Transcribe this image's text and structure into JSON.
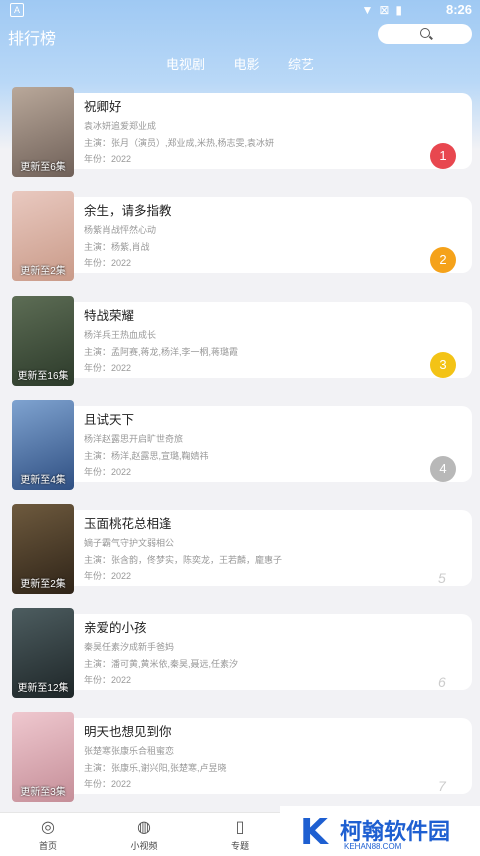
{
  "statusbar": {
    "time": "8:26",
    "app_badge": "A"
  },
  "header": {
    "title": "排行榜"
  },
  "tabs": [
    {
      "label": "电视剧"
    },
    {
      "label": "电影"
    },
    {
      "label": "综艺"
    }
  ],
  "items": [
    {
      "name": "祝卿好",
      "desc": "袁冰妍追爱郑业成",
      "cast": "主演：张月（演员）,郑业成,米热,杨志雯,袁冰妍",
      "year": "年份：2022",
      "episode": "更新至6集",
      "rank": "1",
      "rank_color": "#e8474f",
      "poster_colors": [
        "#b9a89a",
        "#6f6058"
      ]
    },
    {
      "name": "余生，请多指教",
      "desc": "杨紫肖战怦然心动",
      "cast": "主演：杨紫,肖战",
      "year": "年份：2022",
      "episode": "更新至2集",
      "rank": "2",
      "rank_color": "#f5a21a",
      "poster_colors": [
        "#e9c9c0",
        "#c99a88"
      ]
    },
    {
      "name": "特战荣耀",
      "desc": "杨洋兵王热血成长",
      "cast": "主演：孟阿赛,蒋龙,杨洋,李一桐,蒋璐霞",
      "year": "年份：2022",
      "episode": "更新至16集",
      "rank": "3",
      "rank_color": "#f3c316",
      "poster_colors": [
        "#5d6d55",
        "#2c3a2a"
      ]
    },
    {
      "name": "且试天下",
      "desc": "杨洋赵露思开启旷世奇旅",
      "cast": "主演：杨洋,赵露思,宣璐,鞠婧祎",
      "year": "年份：2022",
      "episode": "更新至4集",
      "rank": "4",
      "rank_color": "#b8b8b8",
      "poster_colors": [
        "#7fa3d0",
        "#2f4f82"
      ]
    },
    {
      "name": "玉面桃花总相逢",
      "desc": "嫡子霸气守护文弱相公",
      "cast": "主演：张含韵，佟梦实，陈奕龙，王若麟，龐惠子",
      "year": "年份：2022",
      "episode": "更新至2集",
      "rank": "5",
      "poster_colors": [
        "#6e5a3e",
        "#2f2418"
      ]
    },
    {
      "name": "亲爱的小孩",
      "desc": "秦昊任素汐成新手爸妈",
      "cast": "主演：潘可黄,黄米依,秦昊,聂远,任素汐",
      "year": "年份：2022",
      "episode": "更新至12集",
      "rank": "6",
      "poster_colors": [
        "#4d5d60",
        "#1e2628"
      ]
    },
    {
      "name": "明天也想见到你",
      "desc": "张楚寒张康乐合租蜜恋",
      "cast": "主演：张康乐,谢兴阳,张楚寒,卢昱晓",
      "year": "年份：2022",
      "episode": "更新至3集",
      "rank": "7",
      "poster_colors": [
        "#efc8cf",
        "#c58e98"
      ]
    }
  ],
  "bottom_nav": [
    {
      "label": "首页",
      "icon": "home-circle-icon"
    },
    {
      "label": "小视频",
      "icon": "planet-icon"
    },
    {
      "label": "专题",
      "icon": "bookmark-icon"
    }
  ],
  "watermark": {
    "logo": "K",
    "text": "柯翰软件园",
    "url": "KEHAN88.COM"
  }
}
